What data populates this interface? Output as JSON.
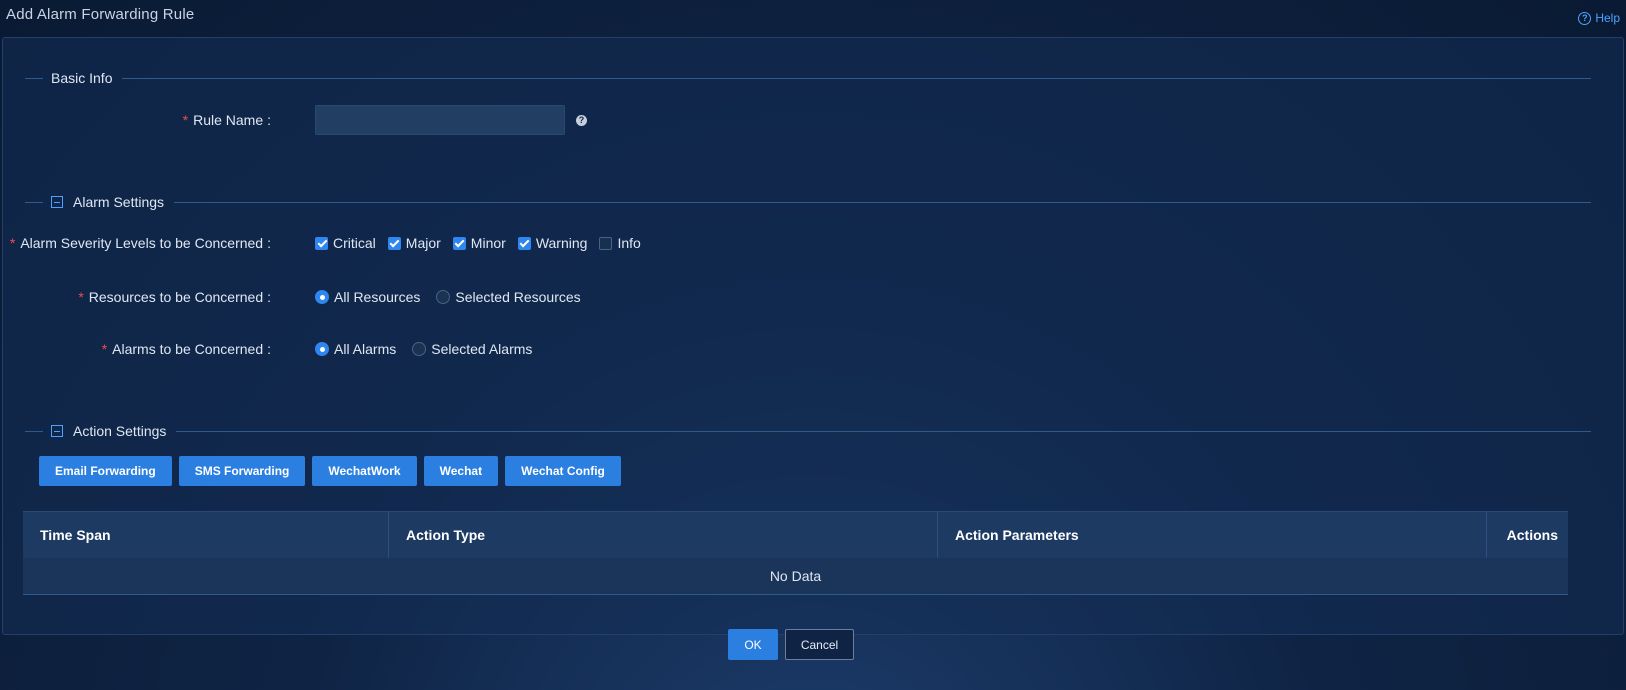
{
  "header": {
    "title": "Add Alarm Forwarding Rule",
    "help_label": "Help"
  },
  "basic_info": {
    "section_title": "Basic Info",
    "rule_name": {
      "label": "Rule Name",
      "value": "",
      "placeholder": ""
    }
  },
  "alarm_settings": {
    "section_title": "Alarm Settings",
    "severity": {
      "label": "Alarm Severity Levels to be Concerned",
      "options": [
        {
          "label": "Critical",
          "checked": true
        },
        {
          "label": "Major",
          "checked": true
        },
        {
          "label": "Minor",
          "checked": true
        },
        {
          "label": "Warning",
          "checked": true
        },
        {
          "label": "Info",
          "checked": false
        }
      ]
    },
    "resources": {
      "label": "Resources to be Concerned",
      "options": [
        {
          "label": "All Resources",
          "selected": true
        },
        {
          "label": "Selected Resources",
          "selected": false
        }
      ]
    },
    "alarms": {
      "label": "Alarms to be Concerned",
      "options": [
        {
          "label": "All Alarms",
          "selected": true
        },
        {
          "label": "Selected Alarms",
          "selected": false
        }
      ]
    }
  },
  "action_settings": {
    "section_title": "Action Settings",
    "buttons": [
      "Email Forwarding",
      "SMS Forwarding",
      "WechatWork",
      "Wechat",
      "Wechat Config"
    ],
    "table": {
      "columns": [
        "Time Span",
        "Action Type",
        "Action Parameters",
        "Actions"
      ],
      "empty_text": "No Data"
    }
  },
  "footer": {
    "ok_label": "OK",
    "cancel_label": "Cancel"
  }
}
